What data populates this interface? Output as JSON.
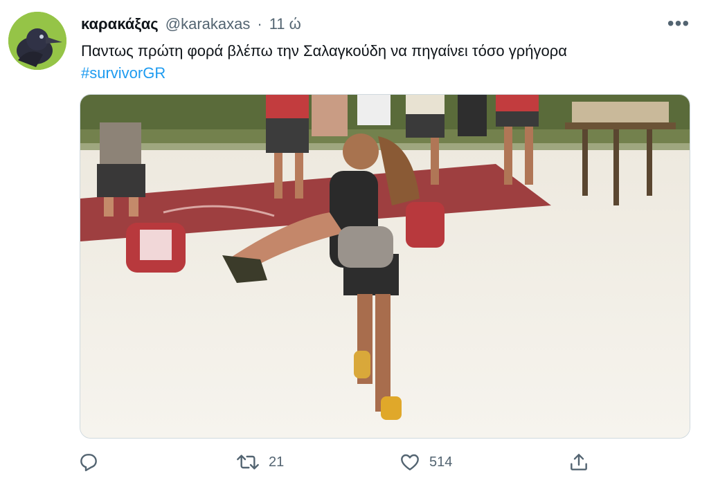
{
  "tweet": {
    "display_name": "καρακάξας",
    "handle": "@karakaxas",
    "separator": "·",
    "time": "11 ώ",
    "text": "Παντως πρώτη φορά βλέπω την Σαλαγκούδη να πηγαίνει τόσο γρήγορα",
    "hashtag": "#survivorGR",
    "more_label": "•••"
  },
  "actions": {
    "reply_count": "",
    "retweet_count": "21",
    "like_count": "514"
  },
  "icons": {
    "avatar": "crow-avatar",
    "more": "more-horizontal-icon",
    "reply": "reply-icon",
    "retweet": "retweet-icon",
    "like": "heart-icon",
    "share": "share-icon"
  },
  "colors": {
    "link": "#1d9bf0",
    "secondary_text": "#536471",
    "primary_text": "#0f1419",
    "avatar_bg": "#8cc63f"
  }
}
